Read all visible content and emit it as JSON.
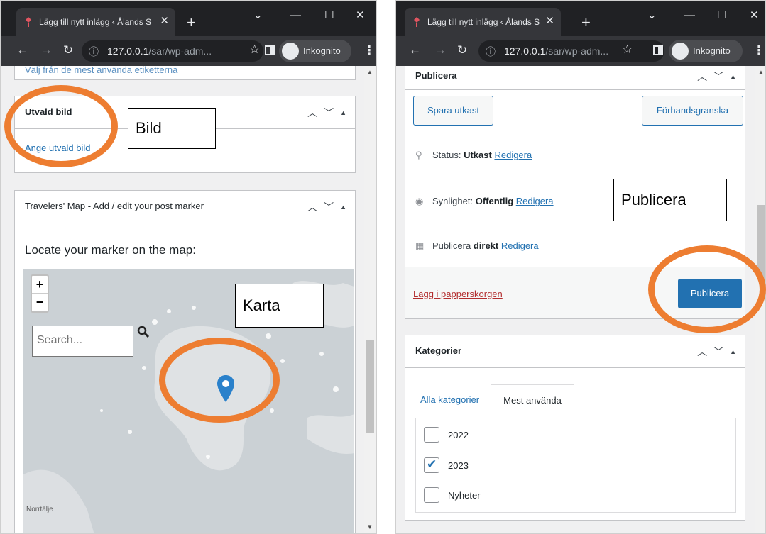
{
  "left_window": {
    "tab_title": "Lägg till nytt inlägg ‹ Ålands S",
    "url_host": "127.0.0.1",
    "url_path": "/sar/wp-adm...",
    "profile_label": "Inkognito",
    "top_link": "Välj från de mest använda etiketterna",
    "featured_image": {
      "title": "Utvald bild",
      "set_link": "Ange utvald bild"
    },
    "map_box": {
      "title": "Travelers' Map - Add / edit your post marker",
      "heading": "Locate your marker on the map:",
      "zoom_in": "+",
      "zoom_out": "−",
      "search_placeholder": "Search...",
      "place_label": "Norrtälje"
    },
    "annotations": {
      "image_label": "Bild",
      "map_label": "Karta"
    }
  },
  "right_window": {
    "tab_title": "Lägg till nytt inlägg ‹ Ålands S",
    "url_host": "127.0.0.1",
    "url_path": "/sar/wp-adm...",
    "profile_label": "Inkognito",
    "publish_box": {
      "title": "Publicera",
      "save_draft": "Spara utkast",
      "preview": "Förhandsgranska",
      "status_label": "Status:",
      "status_value": "Utkast",
      "visibility_label": "Synlighet:",
      "visibility_value": "Offentlig",
      "publish_label": "Publicera",
      "publish_value": "direkt",
      "edit_link": "Redigera",
      "trash_link": "Lägg i papperskorgen",
      "publish_button": "Publicera"
    },
    "categories_box": {
      "title": "Kategorier",
      "tab_all": "Alla kategorier",
      "tab_most_used": "Mest använda",
      "items": [
        {
          "label": "2022",
          "checked": false
        },
        {
          "label": "2023",
          "checked": true
        },
        {
          "label": "Nyheter",
          "checked": false
        }
      ]
    },
    "annotations": {
      "publish_label": "Publicera"
    }
  },
  "colors": {
    "wp_blue": "#2271b1",
    "annotation_orange": "#ed7d31",
    "chrome_dark": "#35363a"
  }
}
